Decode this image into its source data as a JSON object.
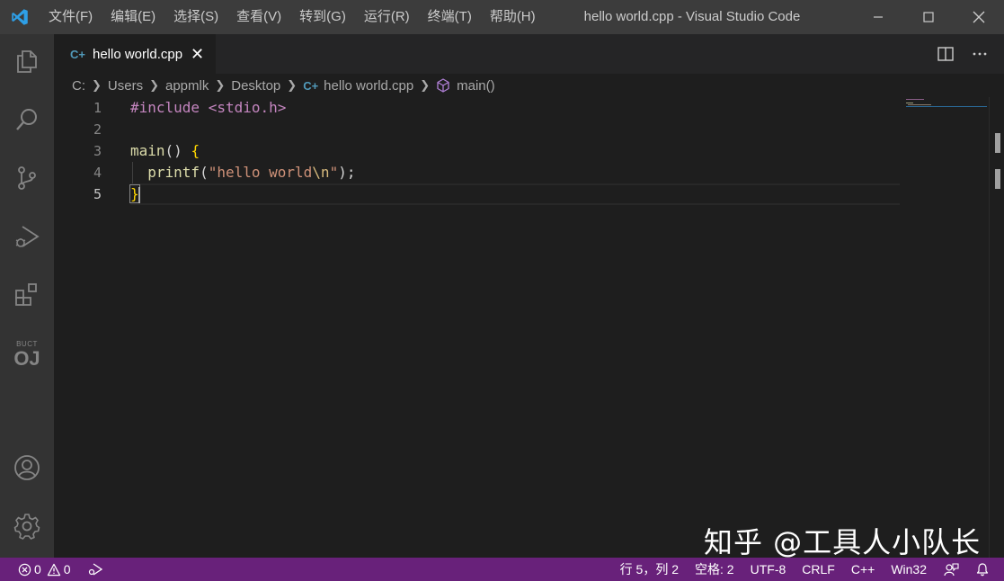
{
  "window": {
    "title": "hello world.cpp - Visual Studio Code"
  },
  "menu": [
    "文件(F)",
    "编辑(E)",
    "选择(S)",
    "查看(V)",
    "转到(G)",
    "运行(R)",
    "终端(T)",
    "帮助(H)"
  ],
  "activitybar": {
    "icons": [
      "explorer-icon",
      "search-icon",
      "source-control-icon",
      "run-debug-icon",
      "extensions-icon",
      "oj-icon",
      "account-icon",
      "settings-gear-icon"
    ],
    "oj_small": "BUCT",
    "oj_big": "OJ"
  },
  "tab": {
    "icon": "C+",
    "label": "hello world.cpp",
    "close": "✕"
  },
  "breadcrumb": {
    "items": [
      "C:",
      "Users",
      "appmlk",
      "Desktop",
      "hello world.cpp",
      "main()"
    ],
    "file_icon": "C+"
  },
  "editor": {
    "line_numbers": [
      "1",
      "2",
      "3",
      "4",
      "5"
    ],
    "active_line": 5,
    "lines": [
      [
        {
          "t": "#include <stdio.h>",
          "c": "pre"
        }
      ],
      [],
      [
        {
          "t": "main",
          "c": "fn"
        },
        {
          "t": "() ",
          "c": "plain"
        },
        {
          "t": "{",
          "c": "br"
        }
      ],
      [
        {
          "t": "  ",
          "c": "plain"
        },
        {
          "t": "printf",
          "c": "fn"
        },
        {
          "t": "(",
          "c": "plain"
        },
        {
          "t": "\"hello world",
          "c": "str"
        },
        {
          "t": "\\n",
          "c": "esc"
        },
        {
          "t": "\"",
          "c": "str"
        },
        {
          "t": ");",
          "c": "plain"
        }
      ],
      [
        {
          "t": "}",
          "c": "br"
        }
      ]
    ]
  },
  "watermark": "知乎 @工具人小队长",
  "status": {
    "errors": "0",
    "warnings": "0",
    "position": "行 5，列 2",
    "spaces": "空格: 2",
    "encoding": "UTF-8",
    "eol": "CRLF",
    "language": "C++",
    "config": "Win32"
  },
  "colors": {
    "titlebar": "#3c3c3c",
    "activitybar": "#333333",
    "editor": "#1e1e1e",
    "statusbar": "#68217a",
    "accent": "#007acc"
  }
}
